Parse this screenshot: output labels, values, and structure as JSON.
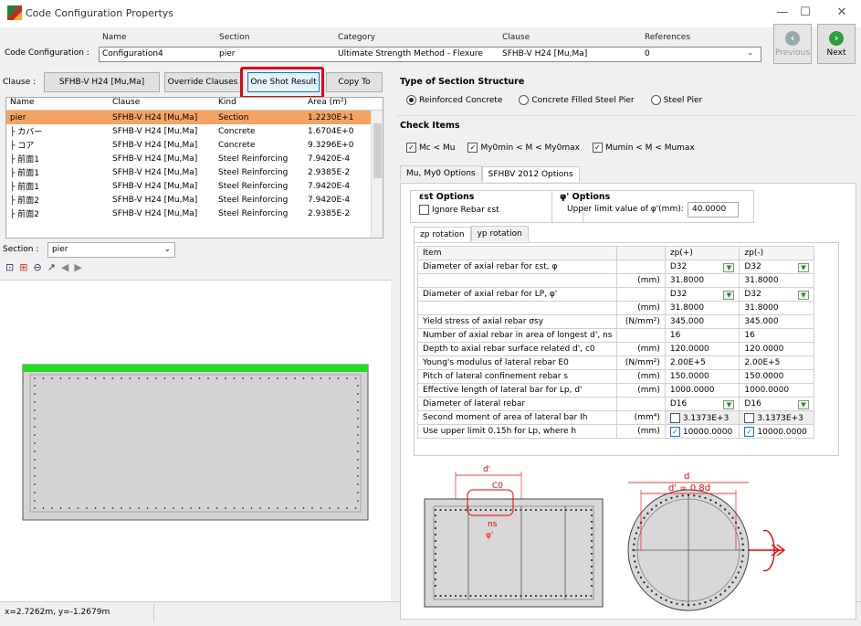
{
  "window": {
    "title": "Code Configuration Propertys",
    "minimize": "—",
    "maximize": "☐",
    "close": "✕"
  },
  "config": {
    "label": "Code Configuration :",
    "headers": {
      "name": "Name",
      "section": "Section",
      "category": "Category",
      "clause": "Clause",
      "references": "References"
    },
    "values": {
      "name": "Configuration4",
      "section": "pier",
      "category": "Ultimate Strength Method - Flexure",
      "clause": "SFHB-V H24 [Mu,Ma]",
      "references": "0"
    },
    "previous": "Previous",
    "next": "Next"
  },
  "toolbar": {
    "clause_label": "Clause :",
    "clause_value": "SFHB-V H24 [Mu,Ma]",
    "override": "Override Clauses",
    "oneshot": "One Shot Result",
    "copyto": "Copy To"
  },
  "list": {
    "headers": [
      "Name",
      "Clause",
      "Kind",
      "Area (m²)"
    ],
    "rows": [
      [
        "pier",
        "SFHB-V H24 [Mu,Ma]",
        "Section",
        "1.2230E+1"
      ],
      [
        "├ カバー",
        "SFHB-V H24 [Mu,Ma]",
        "Concrete",
        "1.6704E+0"
      ],
      [
        "├ コア",
        "SFHB-V H24 [Mu,Ma]",
        "Concrete",
        "9.3296E+0"
      ],
      [
        "├ 前面1",
        "SFHB-V H24 [Mu,Ma]",
        "Steel Reinforcing",
        "7.9420E-4"
      ],
      [
        "├ 前面1",
        "SFHB-V H24 [Mu,Ma]",
        "Steel Reinforcing",
        "2.9385E-2"
      ],
      [
        "├ 前面1",
        "SFHB-V H24 [Mu,Ma]",
        "Steel Reinforcing",
        "7.9420E-4"
      ],
      [
        "├ 前面2",
        "SFHB-V H24 [Mu,Ma]",
        "Steel Reinforcing",
        "7.9420E-4"
      ],
      [
        "├ 前面2",
        "SFHB-V H24 [Mu,Ma]",
        "Steel Reinforcing",
        "2.9385E-2"
      ]
    ]
  },
  "section_select": {
    "label": "Section :",
    "value": "pier"
  },
  "status": {
    "coords": "x=2.7262m, y=-1.2679m"
  },
  "right": {
    "type_title": "Type of Section Structure",
    "types": [
      "Reinforced Concrete",
      "Concrete Filled Steel Pier",
      "Steel Pier"
    ],
    "check_title": "Check Items",
    "checks": [
      "Mc < Mu",
      "My0min < M < My0max",
      "Mumin < M < Mumax"
    ],
    "tabs": [
      "Mu, My0 Options",
      "SFHBV 2012 Options"
    ],
    "est_title": "εst Options",
    "ignore_label": "Ignore Rebar εst",
    "phi_title": "φ' Options",
    "phi_label": "Upper limit value of φ'(mm):",
    "phi_value": "40.0000",
    "subtabs": [
      "zp rotation",
      "yp rotation"
    ],
    "grid_headers": [
      "Item",
      "zp(+)",
      "zp(-)"
    ],
    "grid_rows": [
      [
        "Diameter of axial rebar for εst, φ",
        "",
        "D32",
        "D32",
        "dd"
      ],
      [
        "",
        "(mm)",
        "31.8000",
        "31.8000",
        ""
      ],
      [
        "Diameter of axial rebar for LP, φ'",
        "",
        "D32",
        "D32",
        "dd"
      ],
      [
        "",
        "(mm)",
        "31.8000",
        "31.8000",
        ""
      ],
      [
        "Yield stress of axial rebar σsy",
        "(N/mm²)",
        "345.000",
        "345.000",
        ""
      ],
      [
        "Number of axial rebar in area of longest d', ns",
        "",
        "16",
        "16",
        ""
      ],
      [
        "Depth to axial rebar surface related d', c0",
        "(mm)",
        "120.0000",
        "120.0000",
        ""
      ],
      [
        "Young's modulus of lateral rebar E0",
        "(N/mm²)",
        "2.00E+5",
        "2.00E+5",
        ""
      ],
      [
        "Pitch of lateral confinement rebar s",
        "(mm)",
        "150.0000",
        "150.0000",
        ""
      ],
      [
        "Effective length of lateral bar for Lp, d'",
        "(mm)",
        "1000.0000",
        "1000.0000",
        ""
      ],
      [
        "Diameter of lateral rebar",
        "",
        "D16",
        "D16",
        "dd"
      ],
      [
        "Second moment of area of lateral bar Ih",
        "(mm⁴)",
        "3.1373E+3",
        "3.1373E+3",
        "cb0"
      ],
      [
        "Use upper limit 0.15h for Lp, where h",
        "(mm)",
        "10000.0000",
        "10000.0000",
        "cb1"
      ]
    ],
    "diagram": {
      "d1": "d'",
      "c0": "C0",
      "ns": "ns",
      "phi": "φ'",
      "d2": "d",
      "d2eq": "d' = 0.8d"
    }
  }
}
